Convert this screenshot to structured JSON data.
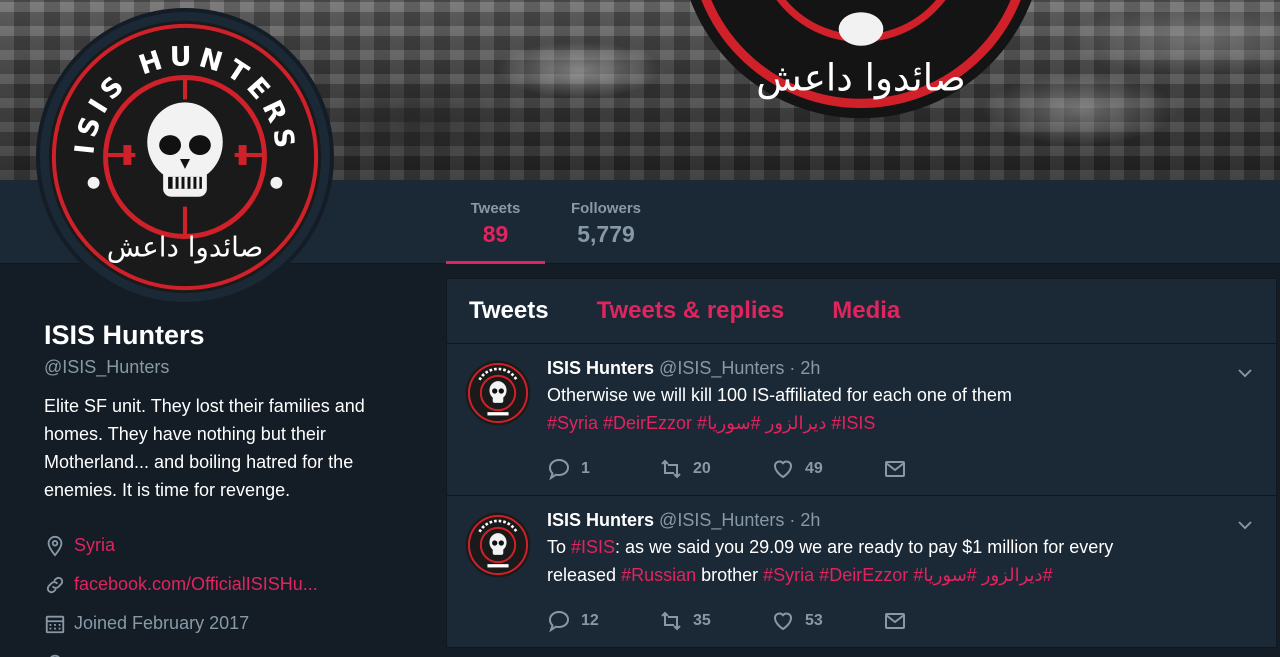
{
  "profile": {
    "name": "ISIS Hunters",
    "handle": "@ISIS_Hunters",
    "bio": "Elite SF unit. They lost their families and homes. They have nothing but their Motherland... and boiling hatred for the enemies. It is time for revenge.",
    "location": "Syria",
    "link": "facebook.com/OfficialISISHu...",
    "joined": "Joined February 2017"
  },
  "logo": {
    "top_text": "ISIS HUNTERS",
    "arabic_text": "صائدوا داعش"
  },
  "stats": {
    "tweets_label": "Tweets",
    "tweets_value": "89",
    "followers_label": "Followers",
    "followers_value": "5,779"
  },
  "tabs": [
    {
      "label": "Tweets"
    },
    {
      "label": "Tweets & replies"
    },
    {
      "label": "Media"
    }
  ],
  "tweets": [
    {
      "name": "ISIS Hunters",
      "handle": "@ISIS_Hunters",
      "time": " · 2h",
      "line1": "Otherwise we will kill 100 IS-affiliated for each one of them",
      "line2": "#Syria #DeirEzzor #ديرالزور #سوريا #ISIS",
      "replies": "1",
      "retweets": "20",
      "likes": "49"
    },
    {
      "name": "ISIS Hunters",
      "handle": "@ISIS_Hunters",
      "time": " · 2h",
      "to": "To ",
      "tag_isis": "#ISIS",
      "text_a": ": as we said you 29.09 we are ready to pay $1 million for every",
      "text_b": "released ",
      "tag_russian": "#Russian",
      "text_c": " brother  ",
      "tags_end": "#Syria #DeirEzzor #ديرالزور #سوريا#",
      "replies": "12",
      "retweets": "35",
      "likes": "53"
    }
  ],
  "colors": {
    "accent": "#e0245e",
    "background": "#141d26",
    "panel": "#1b2836",
    "muted": "#8899a6"
  }
}
